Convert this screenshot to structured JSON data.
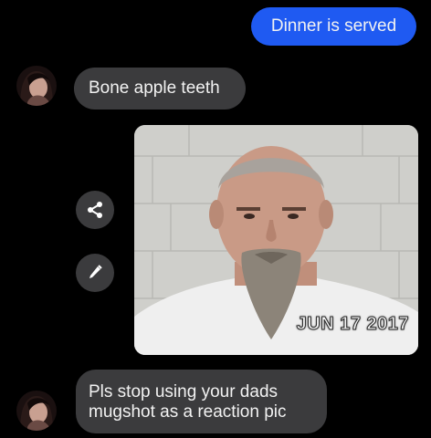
{
  "messages": {
    "outgoing_1": "Dinner is served",
    "incoming_1": "Bone apple teeth",
    "incoming_2_line1": "Pls stop using your dads",
    "incoming_2_line2": "mugshot as a reaction pic"
  },
  "photo": {
    "date_stamp": "JUN 17 2017"
  },
  "icons": {
    "share": "share-icon",
    "edit": "pencil-icon"
  },
  "colors": {
    "background": "#000000",
    "outgoing_bubble": "#1f5af2",
    "incoming_bubble": "#3b3b3d",
    "text": "#f2f2f2"
  }
}
